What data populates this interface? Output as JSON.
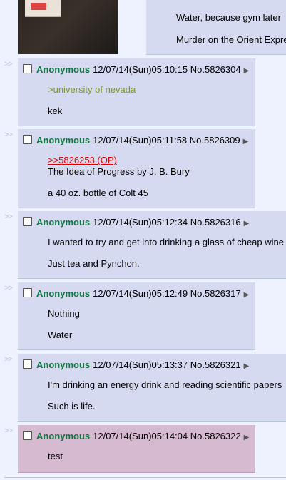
{
  "top_reply": {
    "line1": "Water, because gym later",
    "line2": "Murder on the Orient Expre"
  },
  "side_marker": ">>",
  "menu_glyph": "▶",
  "posts": [
    {
      "name": "Anonymous",
      "datetime": "12/07/14(Sun)05:10:15",
      "no_label": "No.",
      "number": "5826304",
      "lines": [
        ">university of nevada",
        "kek"
      ]
    },
    {
      "name": "Anonymous",
      "datetime": "12/07/14(Sun)05:11:58",
      "no_label": "No.",
      "number": "5826309",
      "quotelink": ">>5826253 (OP)",
      "lines": [
        "The Idea of Progress by J. B. Bury",
        "a 40 oz. bottle of Colt 45"
      ]
    },
    {
      "name": "Anonymous",
      "datetime": "12/07/14(Sun)05:12:34",
      "no_label": "No.",
      "number": "5826316",
      "lines": [
        "I wanted to try and get into drinking a glass of cheap wine",
        "Just tea and Pynchon."
      ]
    },
    {
      "name": "Anonymous",
      "datetime": "12/07/14(Sun)05:12:49",
      "no_label": "No.",
      "number": "5826317",
      "lines": [
        "Nothing",
        "Water"
      ]
    },
    {
      "name": "Anonymous",
      "datetime": "12/07/14(Sun)05:13:37",
      "no_label": "No.",
      "number": "5826321",
      "lines": [
        "I'm drinking an energy drink and reading scientific papers",
        "Such is life."
      ]
    },
    {
      "name": "Anonymous",
      "datetime": "12/07/14(Sun)05:14:04",
      "no_label": "No.",
      "number": "5826322",
      "lines": [
        "test"
      ],
      "highlighted": true
    }
  ],
  "colors": {
    "background": "#eef2ff",
    "reply": "#d6daf0",
    "highlight": "#d6bad0",
    "name": "#117743",
    "greentext": "#789922",
    "quotelink": "#dd0000"
  }
}
